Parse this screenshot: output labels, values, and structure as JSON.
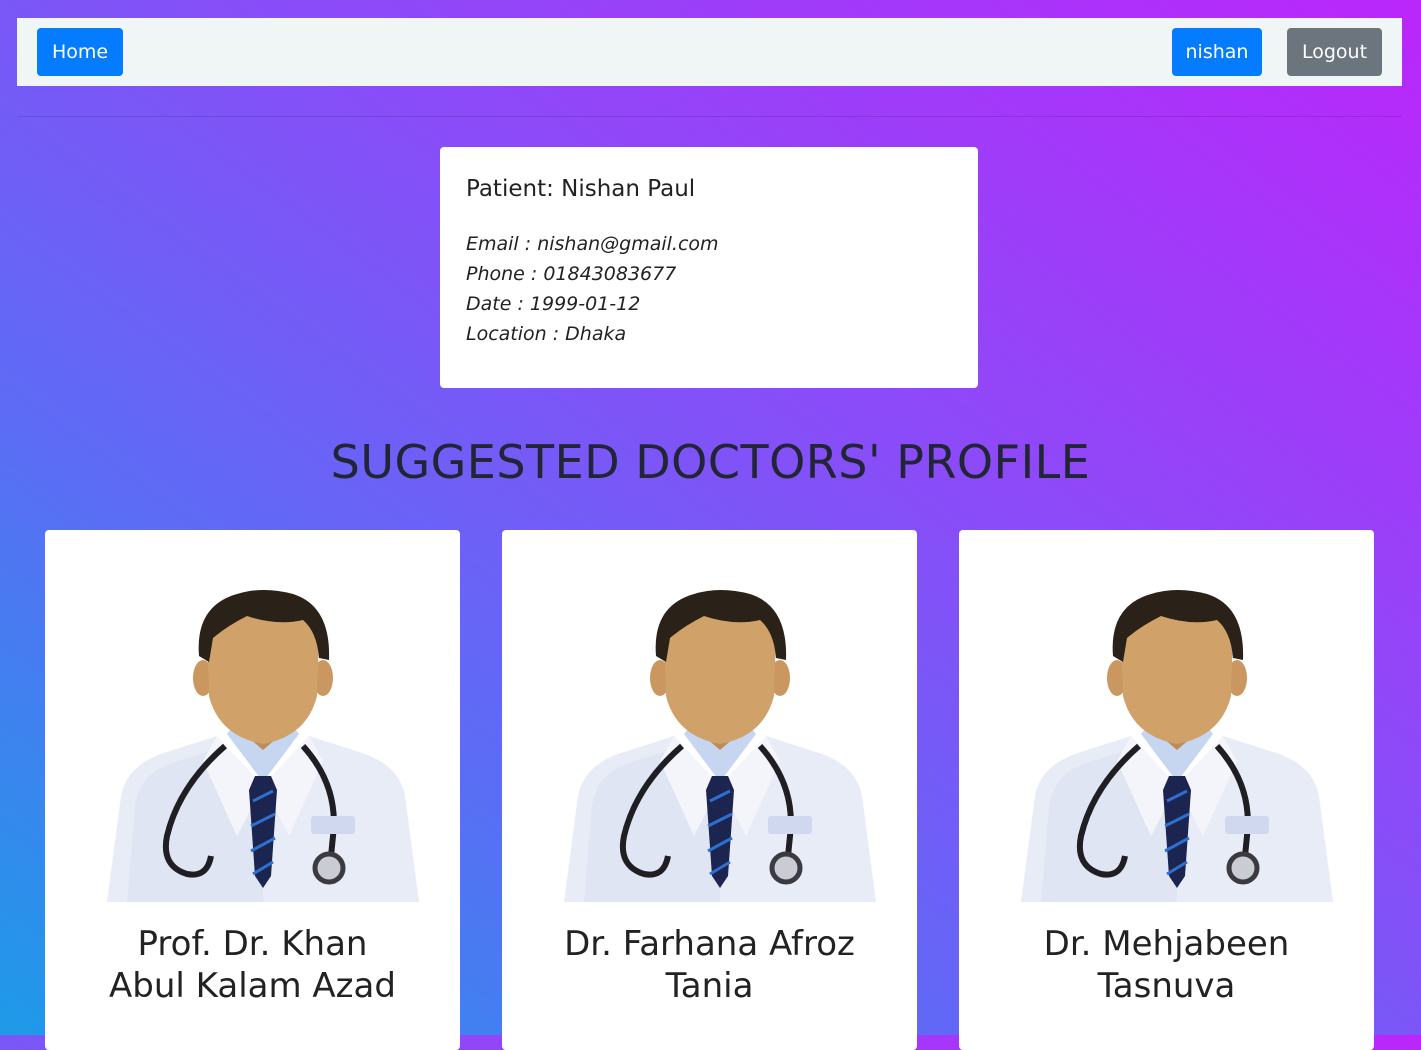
{
  "navbar": {
    "home_label": "Home",
    "user_label": "nishan",
    "logout_label": "Logout"
  },
  "patient": {
    "title": "Patient: Nishan Paul",
    "email": "Email : nishan@gmail.com",
    "phone": "Phone : 01843083677",
    "date": "Date : 1999-01-12",
    "location": "Location : Dhaka"
  },
  "section": {
    "title": "SUGGESTED DOCTORS' PROFILE"
  },
  "doctors": [
    {
      "name_line1": "Prof. Dr. Khan",
      "name_line2": "Abul Kalam Azad",
      "icon": "doctor-avatar-icon"
    },
    {
      "name_line1": "Dr. Farhana Afroz",
      "name_line2": "Tania",
      "icon": "doctor-avatar-icon"
    },
    {
      "name_line1": "Dr. Mehjabeen",
      "name_line2": "Tasnuva",
      "icon": "doctor-avatar-icon"
    }
  ],
  "colors": {
    "primary": "#057bfd",
    "secondary": "#6c757d",
    "navbar_bg": "#f0f5f6",
    "gradient_start": "#1d9be8",
    "gradient_end": "#bb26fb"
  }
}
